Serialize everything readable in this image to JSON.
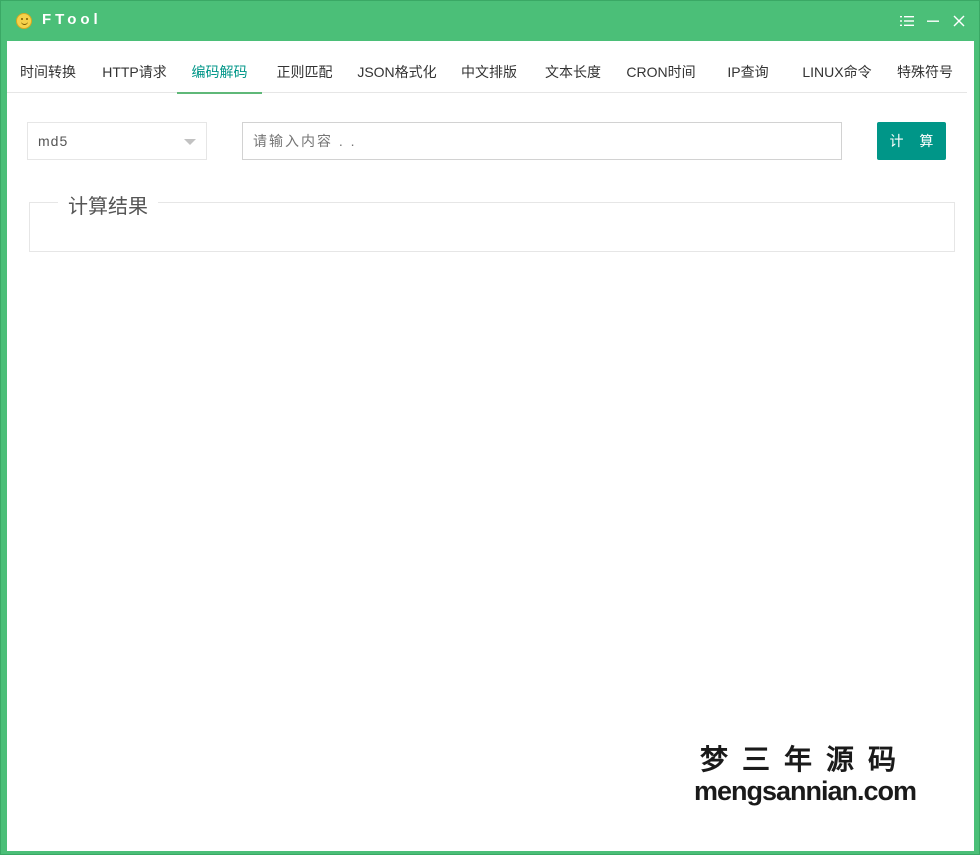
{
  "window": {
    "title": "FTool",
    "controls": [
      "menu-icon",
      "minimize-icon",
      "close-icon"
    ]
  },
  "tabs": [
    {
      "label": "时间转换",
      "active": false
    },
    {
      "label": "HTTP请求",
      "active": false
    },
    {
      "label": "编码解码",
      "active": true
    },
    {
      "label": "正则匹配",
      "active": false
    },
    {
      "label": "JSON格式化",
      "active": false
    },
    {
      "label": "中文排版",
      "active": false
    },
    {
      "label": "文本长度",
      "active": false
    },
    {
      "label": "CRON时间",
      "active": false
    },
    {
      "label": "IP查询",
      "active": false
    },
    {
      "label": "LINUX命令",
      "active": false
    },
    {
      "label": "特殊符号",
      "active": false
    }
  ],
  "form": {
    "algorithm": "md5",
    "input_placeholder": "请输入内容 . .",
    "input_value": "",
    "button_label": "计 算"
  },
  "result": {
    "legend": "计算结果",
    "value": ""
  },
  "watermark": {
    "cn": "梦三年源码",
    "en": "mengsannian.com"
  },
  "colors": {
    "titlebar": "#4bbf78",
    "accent": "#009688",
    "tab_underline": "#5fb878"
  }
}
